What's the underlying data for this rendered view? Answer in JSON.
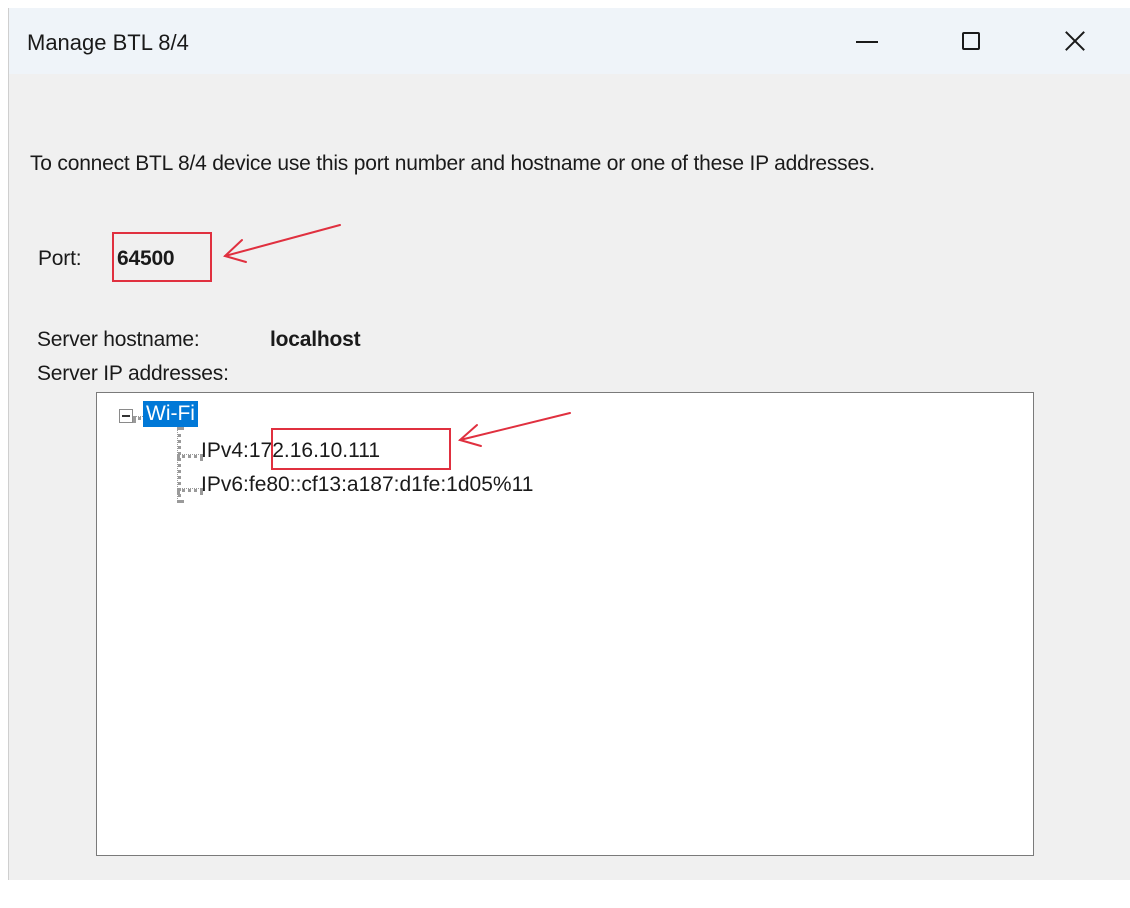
{
  "window": {
    "title": "Manage BTL 8/4",
    "controls": {
      "minimize": "minimize-icon",
      "maximize": "maximize-icon",
      "close": "close-icon"
    }
  },
  "instructions": "To connect BTL 8/4 device use this port number and hostname or one of these IP addresses.",
  "port": {
    "label": "Port:",
    "value": "64500"
  },
  "server": {
    "hostname_label": "Server hostname:",
    "hostname_value": "localhost",
    "ip_label": "Server IP addresses:"
  },
  "tree": {
    "root": "Wi-Fi",
    "children": [
      {
        "label": "IPv4:",
        "value": "172.16.10.111"
      },
      {
        "label": "IPv6:",
        "value": "fe80::cf13:a187:d1fe:1d05%11"
      }
    ]
  },
  "annotations": {
    "highlight_color": "#e0303f",
    "selection_color": "#0078d7"
  }
}
